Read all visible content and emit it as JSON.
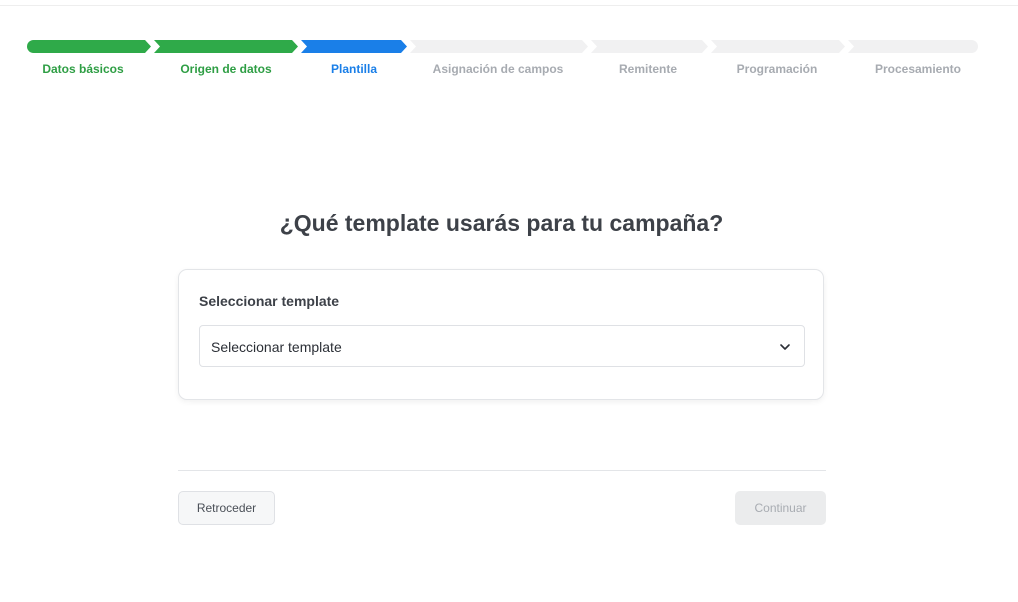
{
  "stepper": {
    "steps": [
      {
        "label": "Datos básicos",
        "status": "completed"
      },
      {
        "label": "Origen de datos",
        "status": "completed"
      },
      {
        "label": "Plantilla",
        "status": "active"
      },
      {
        "label": "Asignación de campos",
        "status": "pending"
      },
      {
        "label": "Remitente",
        "status": "pending"
      },
      {
        "label": "Programación",
        "status": "pending"
      },
      {
        "label": "Procesamiento",
        "status": "pending"
      }
    ]
  },
  "main": {
    "title": "¿Qué template usarás para tu campaña?",
    "template_field": {
      "label": "Seleccionar template",
      "selected_value": "Seleccionar template",
      "icon": "chevron-down-icon"
    }
  },
  "footer": {
    "back_label": "Retroceder",
    "continue_label": "Continuar",
    "continue_disabled": true
  },
  "colors": {
    "completed": "#2faa49",
    "active": "#1a7fe8",
    "pending": "#f1f1f2",
    "title_text": "#3d4148"
  }
}
